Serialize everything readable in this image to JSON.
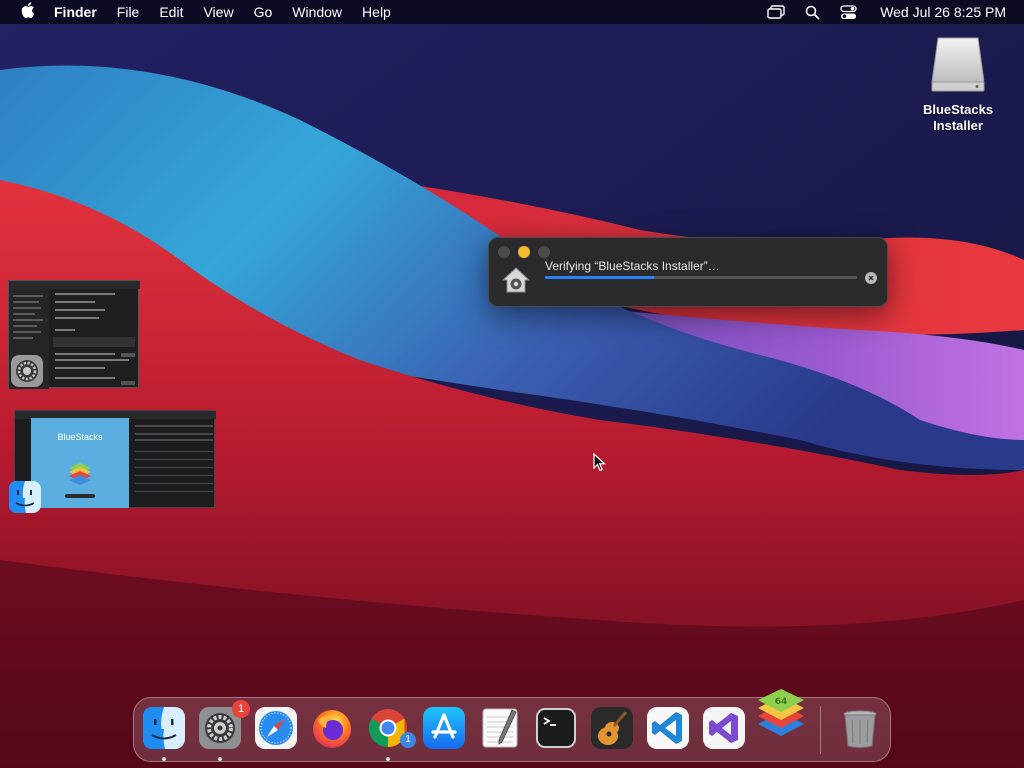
{
  "menubar": {
    "app_name": "Finder",
    "items": [
      "File",
      "Edit",
      "View",
      "Go",
      "Window",
      "Help"
    ],
    "clock": "Wed Jul 26  8:25 PM",
    "icons": [
      "apple-icon",
      "screen-mirroring-icon",
      "spotlight-search-icon",
      "control-center-icon"
    ]
  },
  "desktop": {
    "drive_label_line1": "BlueStacks",
    "drive_label_line2": "Installer"
  },
  "verify_dialog": {
    "title": "Verifying “BlueStacks Installer”…",
    "progress": 0.35
  },
  "thumbnails": {
    "finder_window_title": "BlueStacks"
  },
  "dock": {
    "items": [
      {
        "name": "Finder",
        "running": true
      },
      {
        "name": "System Preferences",
        "running": true,
        "badge": "1"
      },
      {
        "name": "Safari",
        "running": false
      },
      {
        "name": "Firefox",
        "running": false
      },
      {
        "name": "Google Chrome",
        "running": true,
        "badge": "1"
      },
      {
        "name": "App Store",
        "running": false
      },
      {
        "name": "TextEdit",
        "running": false
      },
      {
        "name": "Terminal",
        "running": false
      },
      {
        "name": "GarageBand",
        "running": false
      },
      {
        "name": "Visual Studio Code",
        "running": false
      },
      {
        "name": "Visual Studio",
        "running": false
      },
      {
        "name": "BlueStacks",
        "running": false
      },
      {
        "name": "Trash",
        "running": false
      }
    ]
  },
  "colors": {
    "accent": "#2e80f2",
    "badge": "#e9443a",
    "minimize": "#f5bd2e"
  }
}
